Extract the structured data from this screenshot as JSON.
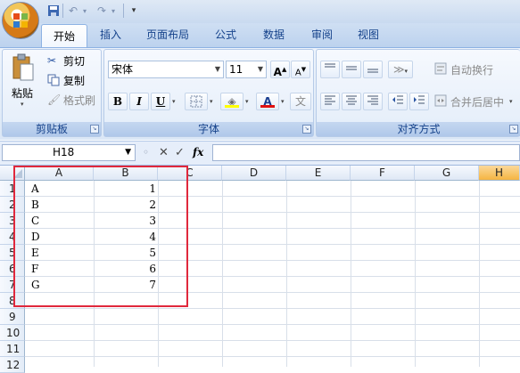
{
  "toolbar": {
    "undo_icon": "↶",
    "redo_icon": "↷",
    "customize_icon": "▾"
  },
  "tabs": [
    {
      "label": "开始"
    },
    {
      "label": "插入"
    },
    {
      "label": "页面布局"
    },
    {
      "label": "公式"
    },
    {
      "label": "数据"
    },
    {
      "label": "审阅"
    },
    {
      "label": "视图"
    }
  ],
  "ribbon": {
    "clipboard": {
      "label": "剪贴板",
      "paste": "粘贴",
      "cut": "剪切",
      "copy": "复制",
      "format_painter": "格式刷"
    },
    "font": {
      "label": "字体",
      "font_name": "宋体",
      "font_size": "11",
      "bold": "B",
      "italic": "I",
      "underline": "U",
      "grow": "A",
      "shrink": "A",
      "font_color_letter": "A",
      "wen": "文"
    },
    "alignment": {
      "label": "对齐方式",
      "wrap_text": "自动换行",
      "merge_center": "合并后居中"
    }
  },
  "formula_bar": {
    "name_box": "H18",
    "fx": "fx",
    "cancel": "✕",
    "enter": "✓",
    "value": ""
  },
  "sheet": {
    "columns": [
      "A",
      "B",
      "C",
      "D",
      "E",
      "F",
      "G",
      "H"
    ],
    "selected_column": "H",
    "rows": [
      "1",
      "2",
      "3",
      "4",
      "5",
      "6",
      "7",
      "8",
      "9",
      "10",
      "11",
      "12"
    ],
    "data": [
      {
        "a": "A",
        "b": "1"
      },
      {
        "a": "B",
        "b": "2"
      },
      {
        "a": "C",
        "b": "3"
      },
      {
        "a": "D",
        "b": "4"
      },
      {
        "a": "E",
        "b": "5"
      },
      {
        "a": "F",
        "b": "6"
      },
      {
        "a": "G",
        "b": "7"
      }
    ]
  },
  "colors": {
    "highlight_box": "#e0283c",
    "selected_header": "#f5b542",
    "font_color_bar": "#e01010"
  }
}
